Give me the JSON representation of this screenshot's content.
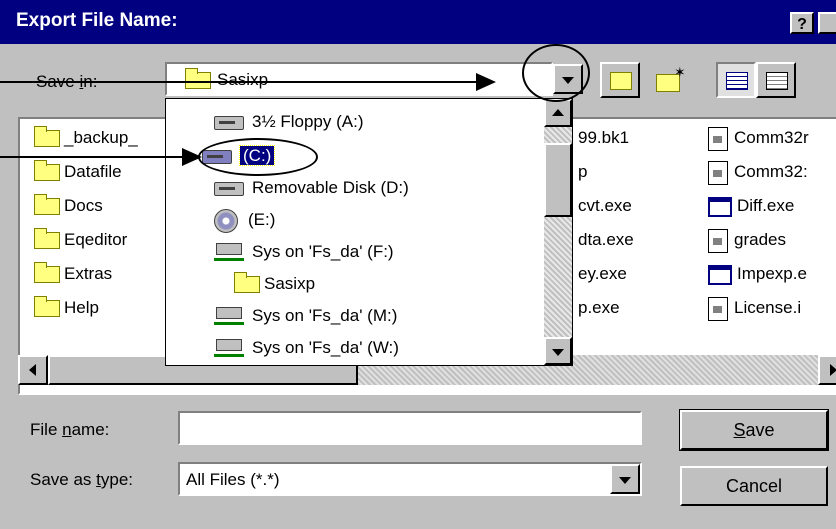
{
  "window": {
    "title": "Export File Name:",
    "help_label": "?"
  },
  "save_in": {
    "label_pre": "Save ",
    "label_underline": "i",
    "label_post": "n:",
    "current": "Sasixp"
  },
  "dropdown_items": [
    {
      "label": "3½ Floppy (A:)",
      "icon": "floppy-drive-icon"
    },
    {
      "label": "(C:)",
      "icon": "hard-drive-icon",
      "selected": true
    },
    {
      "label": "Removable Disk (D:)",
      "icon": "removable-disk-icon"
    },
    {
      "label": "(E:)",
      "icon": "cd-drive-icon"
    },
    {
      "label": "Sys on 'Fs_da' (F:)",
      "icon": "network-drive-icon"
    },
    {
      "label": "Sasixp",
      "icon": "folder-open-icon"
    },
    {
      "label": "Sys on 'Fs_da' (M:)",
      "icon": "network-drive-icon"
    },
    {
      "label": "Sys on 'Fs_da' (W:)",
      "icon": "network-drive-icon"
    }
  ],
  "files_col1": [
    "_backup_",
    "Datafile",
    "Docs",
    "Eqeditor",
    "Extras",
    "Help"
  ],
  "files_col2": [
    "99.bk1",
    "p",
    "cvt.exe",
    "dta.exe",
    "ey.exe",
    "p.exe"
  ],
  "files_col3": [
    "Comm32r",
    "Comm32:",
    "Diff.exe",
    "grades",
    "Impexp.e",
    "License.i"
  ],
  "file_name": {
    "label_pre": "File ",
    "label_underline": "n",
    "label_post": "ame:",
    "value": ""
  },
  "save_as_type": {
    "label_pre": "Save as ",
    "label_underline": "t",
    "label_post": "ype:",
    "value": "All Files (*.*)"
  },
  "buttons": {
    "save_underline": "S",
    "save_rest": "ave",
    "cancel": "Cancel"
  },
  "colors": {
    "title_bar": "#000080",
    "dialog_face": "#c0c0c0",
    "selection": "#000080"
  }
}
